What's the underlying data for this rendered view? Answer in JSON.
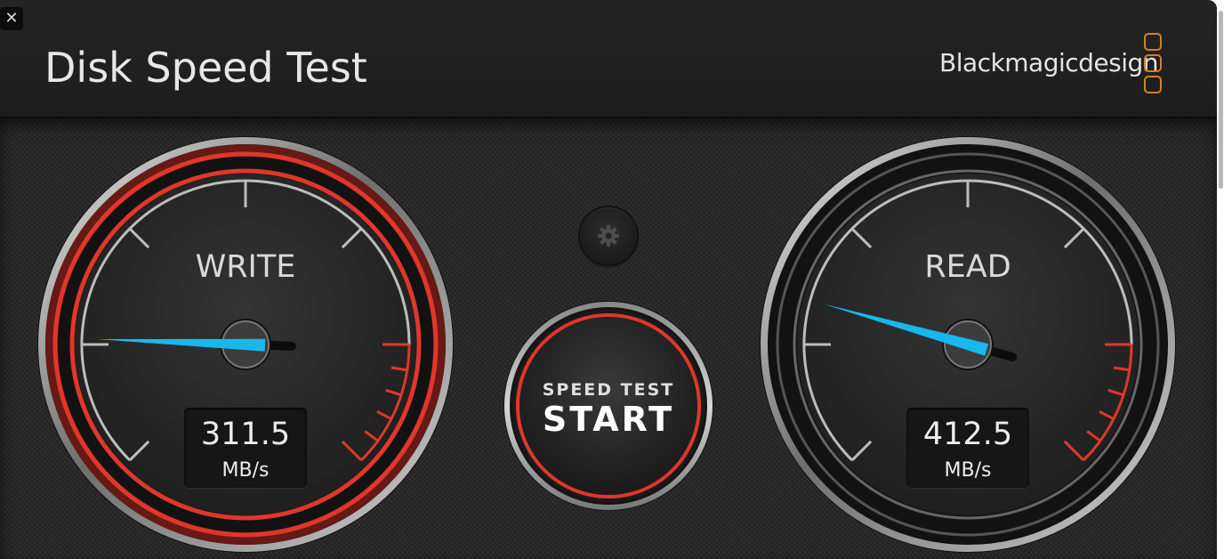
{
  "window": {
    "close_label": "✕",
    "title": "Disk Speed Test",
    "brand": "Blackmagicdesign"
  },
  "gauges": {
    "write": {
      "label": "WRITE",
      "value": "311.5",
      "unit": "MB/s",
      "needle_speed": 311.5,
      "active": true
    },
    "read": {
      "label": "READ",
      "value": "412.5",
      "unit": "MB/s",
      "needle_speed": 412.5,
      "active": false
    }
  },
  "controls": {
    "settings_icon": "gear-icon",
    "start_sub_label": "SPEED TEST",
    "start_label": "START"
  },
  "colors": {
    "accent_red": "#e0372a",
    "needle_blue": "#1ab7ee",
    "brand_orange": "#d4821f"
  }
}
